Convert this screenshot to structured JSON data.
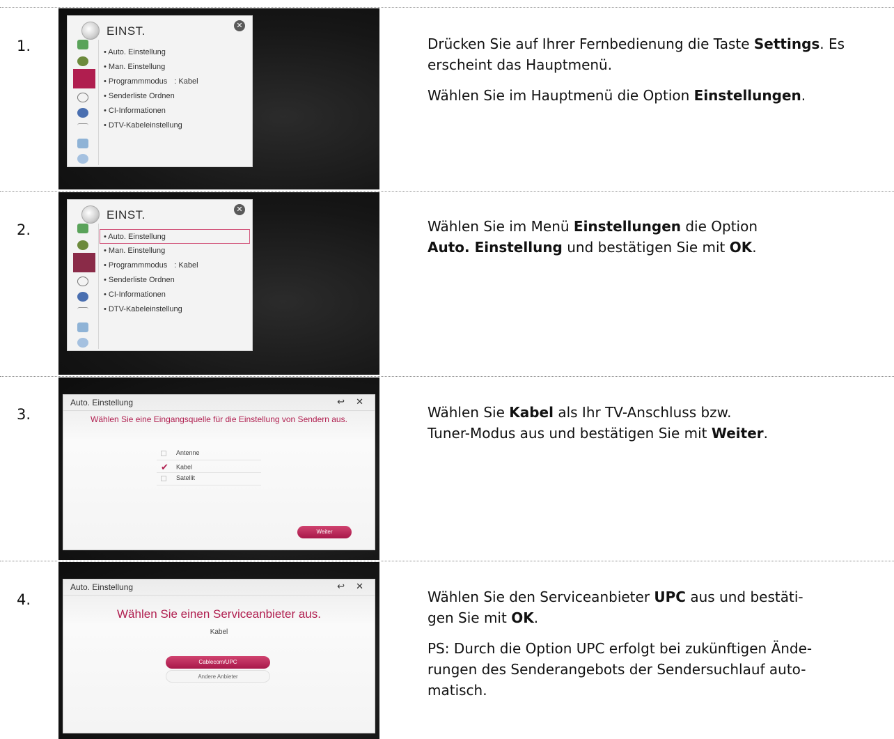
{
  "steps": [
    {
      "number": "1.",
      "screen": {
        "title": "EINST.",
        "close_glyph": "✕",
        "items": [
          {
            "label": "• Auto. Einstellung",
            "value": ""
          },
          {
            "label": "• Man. Einstellung",
            "value": ""
          },
          {
            "label": "• Programmmodus",
            "value": ": Kabel"
          },
          {
            "label": "• Senderliste Ordnen",
            "value": ""
          },
          {
            "label": "• CI-Informationen",
            "value": ""
          },
          {
            "label": "• DTV-Kabeleinstellung",
            "value": ""
          }
        ]
      },
      "text": [
        {
          "parts": [
            "Drücken Sie auf Ihrer Fernbedienung die Taste ",
            "Settings",
            ". Es erscheint das Hauptmenü."
          ]
        },
        {
          "parts": [
            "Wählen Sie im Hauptmenü die Option ",
            "Einstellungen",
            "."
          ]
        }
      ]
    },
    {
      "number": "2.",
      "screen": {
        "title": "EINST.",
        "close_glyph": "✕",
        "items": [
          {
            "label": "• Auto. Einstellung",
            "value": ""
          },
          {
            "label": "• Man. Einstellung",
            "value": ""
          },
          {
            "label": "• Programmmodus",
            "value": ": Kabel"
          },
          {
            "label": "• Senderliste Ordnen",
            "value": ""
          },
          {
            "label": "• CI-Informationen",
            "value": ""
          },
          {
            "label": "• DTV-Kabeleinstellung",
            "value": ""
          }
        ]
      },
      "text": [
        {
          "parts": [
            "Wählen Sie im Menü ",
            "Einstellungen",
            " die Option"
          ]
        },
        {
          "parts": [
            "",
            "Auto. Einstellung",
            " und bestätigen Sie mit ",
            "OK",
            "."
          ]
        }
      ]
    },
    {
      "number": "3.",
      "screen": {
        "title": "Auto. Einstellung",
        "controls": "↩ ✕",
        "prompt": "Wählen Sie eine Eingangsquelle für die Einstellung von Sendern aus.",
        "options": [
          {
            "label": "Antenne",
            "checked": false
          },
          {
            "label": "Kabel",
            "checked": true
          },
          {
            "label": "Satellit",
            "checked": false
          }
        ],
        "check_glyph": "✔",
        "button": "Weiter"
      },
      "text": [
        {
          "parts": [
            "Wählen Sie ",
            "Kabel",
            " als Ihr TV-Anschluss bzw."
          ]
        },
        {
          "parts": [
            "Tuner-Modus aus und bestätigen Sie mit ",
            "Weiter",
            "."
          ]
        }
      ]
    },
    {
      "number": "4.",
      "screen": {
        "title": "Auto. Einstellung",
        "controls": "↩ ✕",
        "prompt": "Wählen Sie einen Serviceanbieter aus.",
        "subtitle": "Kabel",
        "button_primary": "Cablecom/UPC",
        "button_secondary": "Andere Anbieter"
      },
      "text": [
        {
          "parts": [
            "Wählen Sie den Serviceanbieter ",
            "UPC",
            " aus und bestäti-"
          ]
        },
        {
          "parts": [
            "gen Sie mit ",
            "OK",
            "."
          ]
        },
        {
          "parts": [
            "PS: Durch die Option UPC erfolgt bei zukünftigen Ände-"
          ]
        },
        {
          "parts": [
            "rungen des Senderangebots der Sendersuchlauf auto-"
          ]
        },
        {
          "parts": [
            "matisch."
          ]
        }
      ]
    }
  ]
}
